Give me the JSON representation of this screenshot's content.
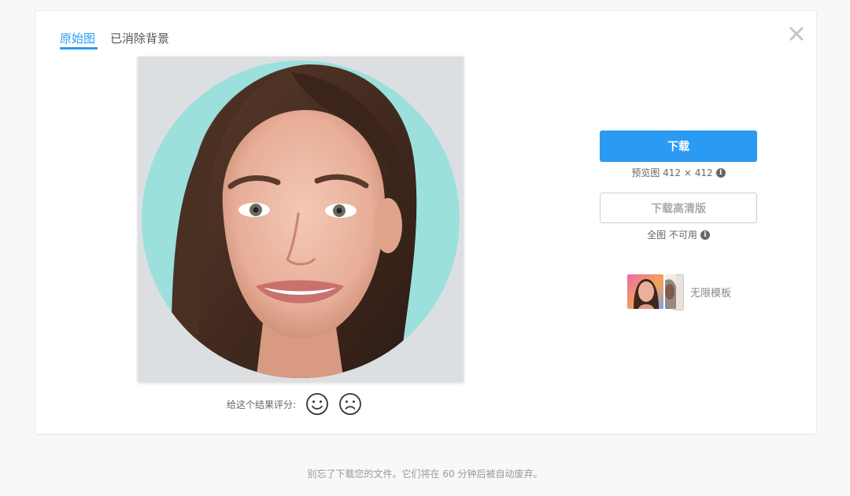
{
  "tabs": [
    {
      "label": "原始图",
      "active": true
    },
    {
      "label": "已消除背景",
      "active": false
    }
  ],
  "close_icon": "close-icon",
  "preview": {
    "background_color": "#dcdfe2",
    "circle_color": "#9be0dc"
  },
  "rating": {
    "label": "给这个结果评分:",
    "good_icon": "smile-icon",
    "bad_icon": "frown-icon"
  },
  "download": {
    "button_label": "下载",
    "note": "预览图 412 × 412",
    "accent": "#2b9af3"
  },
  "download_hd": {
    "button_label": "下载高清版",
    "note": "全图 不可用"
  },
  "templates": {
    "label": "无限模板"
  },
  "footer": {
    "text": "别忘了下载您的文件。它们将在 60 分钟后被自动废弃。"
  }
}
